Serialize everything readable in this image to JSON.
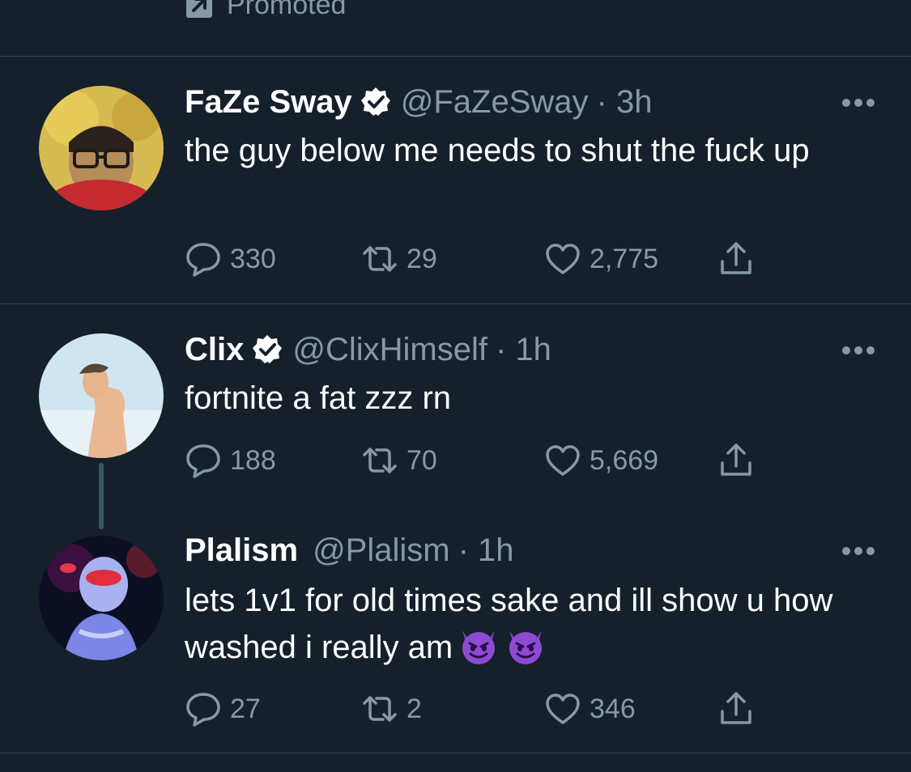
{
  "promoted_label": "Promoted",
  "tweets": [
    {
      "name": "FaZe Sway",
      "verified": true,
      "handle": "@FaZeSway",
      "time": "· 3h",
      "text": "the guy below me needs to shut the fuck up",
      "replies": "330",
      "retweets": "29",
      "likes": "2,775"
    },
    {
      "name": "Clix",
      "verified": true,
      "handle": "@ClixHimself",
      "time": "· 1h",
      "text": "fortnite a fat zzz rn",
      "replies": "188",
      "retweets": "70",
      "likes": "5,669"
    },
    {
      "name": "Plalism",
      "verified": false,
      "handle": "@Plalism",
      "time": "· 1h",
      "text": "lets 1v1 for old times sake and ill show u how washed i really am",
      "emoji": "smiling-devil-emoji",
      "replies": "27",
      "retweets": "2",
      "likes": "346"
    }
  ],
  "colors": {
    "background": "#15202b",
    "secondary_text": "#8899a6",
    "divider": "#38444d",
    "thread_line": "#3d5466"
  }
}
